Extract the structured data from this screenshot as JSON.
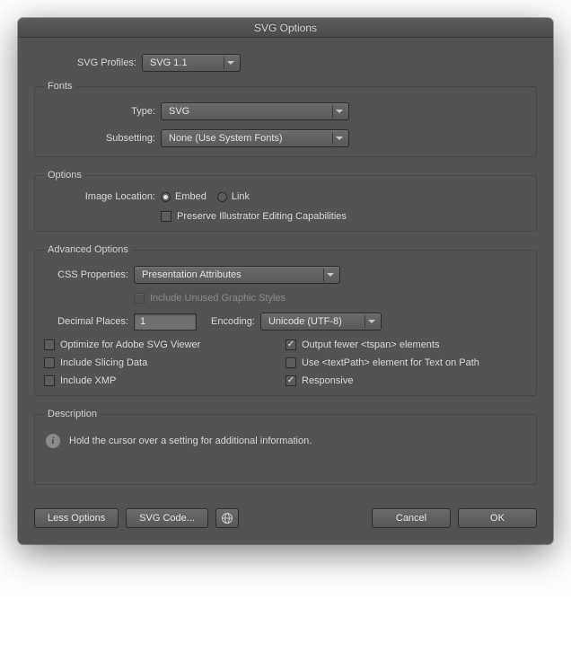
{
  "title": "SVG Options",
  "profiles": {
    "label": "SVG Profiles:",
    "value": "SVG 1.1"
  },
  "fonts": {
    "legend": "Fonts",
    "type": {
      "label": "Type:",
      "value": "SVG"
    },
    "subsetting": {
      "label": "Subsetting:",
      "value": "None (Use System Fonts)"
    }
  },
  "options": {
    "legend": "Options",
    "imageLocation": {
      "label": "Image Location:",
      "embed": "Embed",
      "link": "Link",
      "selected": "embed"
    },
    "preserve": {
      "label": "Preserve Illustrator Editing Capabilities",
      "checked": false
    }
  },
  "advanced": {
    "legend": "Advanced Options",
    "css": {
      "label": "CSS Properties:",
      "value": "Presentation Attributes"
    },
    "includeUnused": {
      "label": "Include Unused Graphic Styles",
      "checked": false,
      "disabled": true
    },
    "decimal": {
      "label": "Decimal Places:",
      "value": "1"
    },
    "encoding": {
      "label": "Encoding:",
      "value": "Unicode (UTF-8)"
    },
    "checks": {
      "optimize": {
        "label": "Optimize for Adobe SVG Viewer",
        "checked": false
      },
      "outputFewer": {
        "label": "Output fewer <tspan> elements",
        "checked": true
      },
      "slicing": {
        "label": "Include Slicing Data",
        "checked": false
      },
      "textPath": {
        "label": "Use <textPath> element for Text on Path",
        "checked": false
      },
      "xmp": {
        "label": "Include XMP",
        "checked": false
      },
      "responsive": {
        "label": "Responsive",
        "checked": true
      }
    }
  },
  "description": {
    "legend": "Description",
    "text": "Hold the cursor over a setting for additional information."
  },
  "footer": {
    "lessOptions": "Less Options",
    "svgCode": "SVG Code...",
    "cancel": "Cancel",
    "ok": "OK"
  }
}
